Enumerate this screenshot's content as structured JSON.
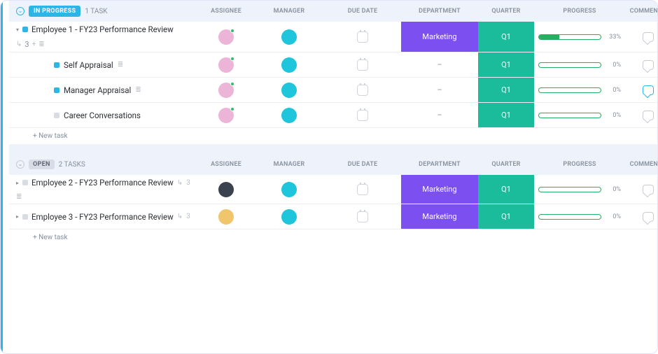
{
  "columns": {
    "assignee": "ASSIGNEE",
    "manager": "MANAGER",
    "due": "DUE DATE",
    "dept": "DEPARTMENT",
    "quarter": "QUARTER",
    "progress": "PROGRESS",
    "comments": "COMMENTS"
  },
  "groups": [
    {
      "status_label": "IN PROGRESS",
      "status_style": "pill-inprogress",
      "count_label": "1 TASK",
      "new_task_label": "+ New task",
      "rows": [
        {
          "title": "Employee 1 - FY23 Performance Review",
          "expanded": true,
          "status": "sq-blue",
          "subtask_badge": "3",
          "assignee_class": "av1",
          "manager_class": "av2",
          "dept": "Marketing",
          "quarter": "Q1",
          "progress_pct": 33,
          "progress_label": "33%",
          "children": [
            {
              "title": "Self Appraisal",
              "status": "sq-cyan",
              "assignee_class": "av1",
              "manager_class": "av2",
              "dept": "",
              "quarter": "Q1",
              "progress_pct": 0,
              "progress_label": "0%",
              "dash": true
            },
            {
              "title": "Manager Appraisal",
              "status": "sq-cyan",
              "assignee_class": "av1",
              "manager_class": "av2",
              "dept": "",
              "quarter": "Q1",
              "progress_pct": 0,
              "progress_label": "0%",
              "dash": true,
              "highlight_comment": true
            },
            {
              "title": "Career Conversations",
              "status": "sq-grey",
              "assignee_class": "av1",
              "manager_class": "av2",
              "dept": "",
              "quarter": "Q1",
              "progress_pct": 0,
              "progress_label": "0%",
              "dash": true
            }
          ]
        }
      ]
    },
    {
      "status_label": "OPEN",
      "status_style": "pill-open",
      "count_label": "2 TASKS",
      "new_task_label": "+ New task",
      "rows": [
        {
          "title": "Employee 2 - FY23 Performance Review",
          "expanded": false,
          "status": "sq-grey",
          "subtask_badge": "3",
          "assignee_class": "av4",
          "manager_class": "av2",
          "dept": "Marketing",
          "quarter": "Q1",
          "progress_pct": 0,
          "progress_label": "0%"
        },
        {
          "title": "Employee 3 - FY23 Performance Review",
          "expanded": false,
          "status": "sq-grey",
          "subtask_badge": "3",
          "assignee_class": "av3",
          "manager_class": "av2",
          "dept": "Marketing",
          "quarter": "Q1",
          "progress_pct": 0,
          "progress_label": "0%"
        }
      ]
    }
  ]
}
